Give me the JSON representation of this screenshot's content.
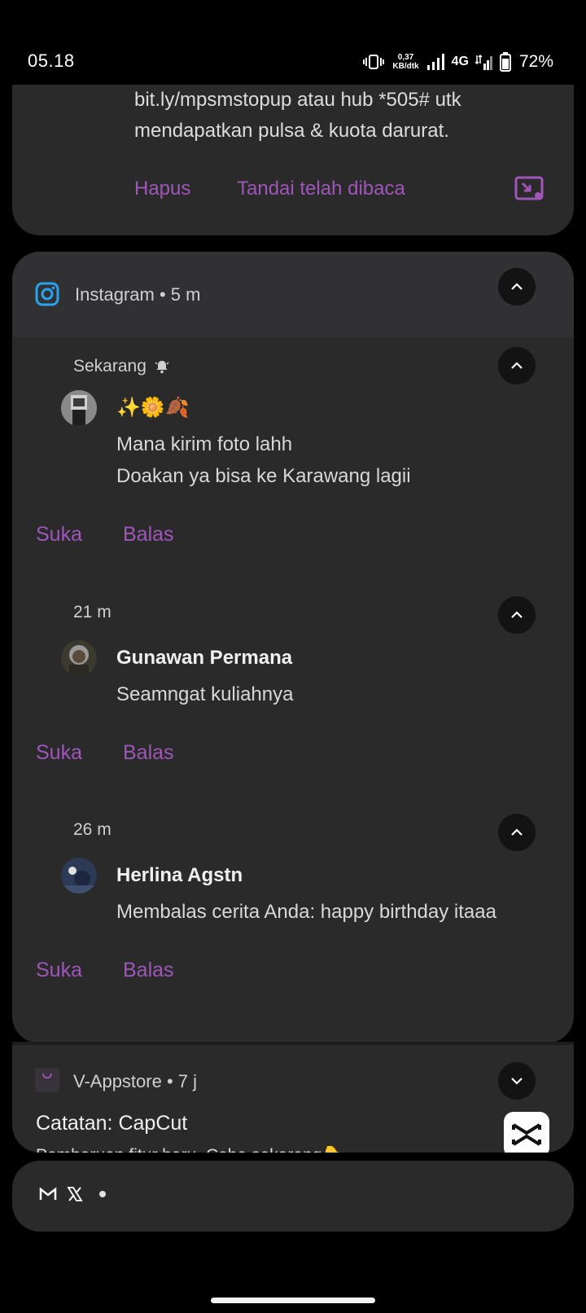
{
  "status_bar": {
    "time": "05.18",
    "net_speed_value": "0,37",
    "net_speed_unit": "KB/dtk",
    "network": "4G",
    "battery": "72%"
  },
  "sms_notification": {
    "text_line1": "bit.ly/mpsmstopup atau hub *505# utk",
    "text_line2": "mendapatkan pulsa & kuota darurat.",
    "action_delete": "Hapus",
    "action_mark_read": "Tandai telah dibaca",
    "open_icon": "open-in-window-icon"
  },
  "instagram": {
    "app_name": "Instagram",
    "app_time": "5 m",
    "messages": [
      {
        "time": "Sekarang",
        "alert_icon": "bell-icon",
        "emoji": "✨🌼🍂",
        "line1": "Mana kirim foto lahh",
        "line2": "Doakan ya bisa ke Karawang lagii",
        "like": "Suka",
        "reply": "Balas"
      },
      {
        "time": "21 m",
        "sender": "Gunawan Permana",
        "text": "Seamngat kuliahnya",
        "like": "Suka",
        "reply": "Balas"
      },
      {
        "time": "26 m",
        "sender": "Herlina Agstn",
        "text": "Membalas cerita Anda: happy birthday itaaa",
        "like": "Suka",
        "reply": "Balas"
      }
    ]
  },
  "vappstore": {
    "app_name": "V-Appstore",
    "app_time": "7 j",
    "title": "Catatan: CapCut",
    "text": "Pembaruan fitur baru. Coba sekarang👇",
    "icon": "capcut-icon"
  },
  "mini_bar": {
    "icons": [
      "gmail-icon",
      "x-icon"
    ]
  },
  "colors": {
    "accent": "#9e56b8",
    "card": "#2a2a2b",
    "background": "#000000"
  }
}
